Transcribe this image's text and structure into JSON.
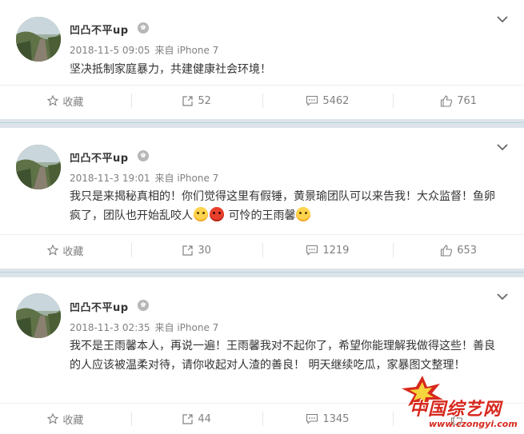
{
  "posts": [
    {
      "username": "凹凸不平up",
      "badge": "♚",
      "date": "2018-11-5 09:05",
      "source": "来自 iPhone 7",
      "content": "坚决抵制家庭暴力，共建健康社会环境！",
      "actions": {
        "favorite": "收藏",
        "repost": "52",
        "comment": "5462",
        "like": "761"
      }
    },
    {
      "username": "凹凸不平up",
      "badge": "♚",
      "date": "2018-11-3 19:01",
      "source": "来自 iPhone 7",
      "content_a": "我只是来揭秘真相的！你们觉得这里有假锤，黄景瑜团队可以来告我！大众监督！鱼卵疯了，团队也开始乱咬人",
      "content_b": " 可怜的王雨馨",
      "actions": {
        "favorite": "收藏",
        "repost": "30",
        "comment": "1219",
        "like": "653"
      }
    },
    {
      "username": "凹凸不平up",
      "badge": "♚",
      "date": "2018-11-3 02:35",
      "source": "来自 iPhone 7",
      "content": "我不是王雨馨本人，再说一遍！王雨馨我对不起你了，希望你能理解我做得这些！善良的人应该被温柔对待，请你收起对人渣的善良！ 明天继续吃瓜，家暴图文整理！",
      "actions": {
        "favorite": "收藏",
        "repost": "44",
        "comment": "1345",
        "like": ""
      }
    }
  ],
  "watermark": {
    "title": "中国综艺网",
    "url": "www.czongyi.com"
  },
  "icons": {
    "favorite": "star-icon",
    "repost": "share-box-icon",
    "comment": "comment-icon",
    "like": "thumbs-up-icon",
    "more": "chevron-down-icon"
  },
  "colors": {
    "separator": "#dce4ea",
    "text": "#333333",
    "muted": "#808080",
    "watermark": "#d7281e"
  }
}
